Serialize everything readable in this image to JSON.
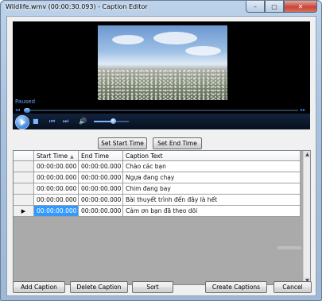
{
  "window": {
    "title": "Wildlife.wmv (00:00:30.093) - Caption Editor",
    "minimize_glyph": "–",
    "maximize_glyph": "▢",
    "close_glyph": "✕"
  },
  "player": {
    "status": "Paused",
    "volume_level": 0.55,
    "seek_position": 0
  },
  "timing_buttons": {
    "set_start": "Set Start Time",
    "set_end": "Set End Time"
  },
  "grid": {
    "columns": [
      "Start Time",
      "End Time",
      "Caption Text"
    ],
    "sort_glyph": "▲",
    "current_row_glyph": "▶",
    "rows": [
      {
        "start": "00:00:00.000",
        "end": "00:00:00.000",
        "text": "Chào các bạn"
      },
      {
        "start": "00:00:00.000",
        "end": "00:00:00.000",
        "text": "Ngựa đang chạy"
      },
      {
        "start": "00:00:00.000",
        "end": "00:00:00.000",
        "text": "Chim đang bay"
      },
      {
        "start": "00:00:00.000",
        "end": "00:00:00.000",
        "text": "Bài thuyết trình đến đây là hết"
      },
      {
        "start": "00:00:00.000",
        "end": "00:00:00.000",
        "text": "Cảm ơn bạn đã theo dõi"
      }
    ]
  },
  "footer": {
    "add": "Add Caption",
    "delete": "Delete Caption",
    "sort": "Sort",
    "create": "Create Captions",
    "cancel": "Cancel"
  }
}
